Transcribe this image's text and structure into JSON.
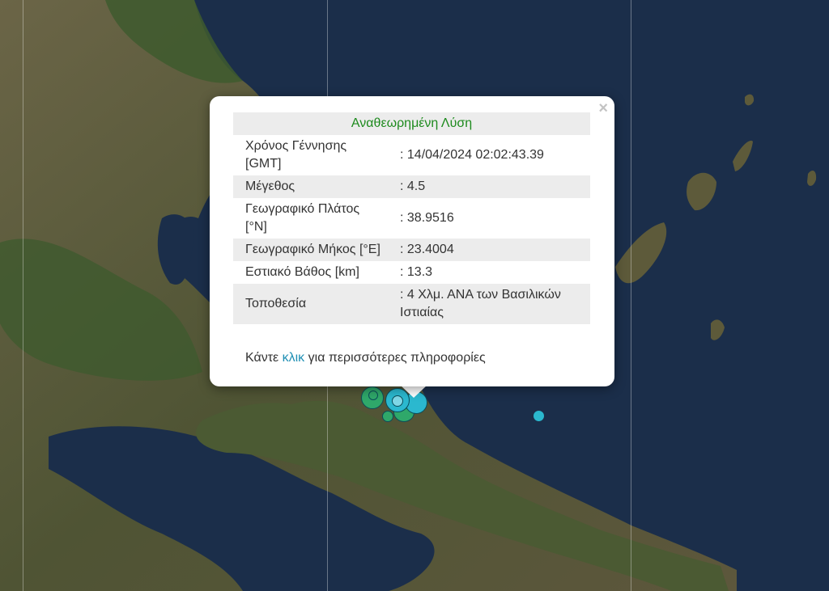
{
  "popup": {
    "title": "Αναθεωρημένη Λύση",
    "close_symbol": "×",
    "rows": [
      {
        "label": "Χρόνος Γέννησης [GMT]",
        "value": ": 14/04/2024 02:02:43.39"
      },
      {
        "label": "Μέγεθος",
        "value": ": 4.5"
      },
      {
        "label": "Γεωγραφικό Πλάτος [°N]",
        "value": ": 38.9516"
      },
      {
        "label": "Γεωγραφικό Μήκος [°E]",
        "value": ": 23.4004"
      },
      {
        "label": "Εστιακό Βάθος [km]",
        "value": ": 13.3"
      },
      {
        "label": "Τοποθεσία",
        "value": ": 4 Χλμ. ΑΝΑ των Βασιλικών Ιστιαίας"
      }
    ],
    "more_prefix": "Κάντε ",
    "more_link": "κλικ",
    "more_suffix": " για περισσότερες πληροφορίες"
  },
  "map": {
    "type": "satellite",
    "colors": {
      "sea": "#1b2e4a",
      "land": "#5f5a3e",
      "forest": "#3e5a2e",
      "quake_green": "#2fa86a",
      "quake_cyan": "#2bb8cf"
    }
  }
}
